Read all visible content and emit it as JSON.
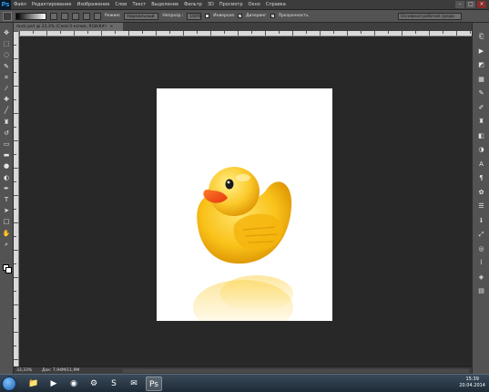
{
  "app": {
    "logo": "Ps"
  },
  "menu": [
    "Файл",
    "Редактирование",
    "Изображение",
    "Слои",
    "Текст",
    "Выделение",
    "Фильтр",
    "3D",
    "Просмотр",
    "Окно",
    "Справка"
  ],
  "window_controls": {
    "minimize": "–",
    "maximize": "□",
    "close": "×"
  },
  "options": {
    "mode_label": "Режим:",
    "mode_value": "Нормальный",
    "opacity_label": "Непрозр.:",
    "opacity_value": "100%",
    "inversion_label": "Инверсия",
    "dither_label": "Дизеринг",
    "transparency_label": "Прозрачность",
    "workspace": "Основная рабочая среда"
  },
  "document_tab": {
    "title": "duck.psd @ 33,3% (Слой 0 копия, RGB/8#)",
    "close": "×"
  },
  "status": {
    "zoom": "33,33%",
    "doc_info": "Док: 7,94M/11,9M"
  },
  "tools": [
    {
      "name": "move-tool-icon",
      "glyph": "✥"
    },
    {
      "name": "marquee-tool-icon",
      "glyph": "⬚"
    },
    {
      "name": "lasso-tool-icon",
      "glyph": "◌"
    },
    {
      "name": "quick-select-tool-icon",
      "glyph": "✎"
    },
    {
      "name": "crop-tool-icon",
      "glyph": "⌗"
    },
    {
      "name": "eyedropper-tool-icon",
      "glyph": "⁄"
    },
    {
      "name": "healing-brush-tool-icon",
      "glyph": "✚"
    },
    {
      "name": "brush-tool-icon",
      "glyph": "╱"
    },
    {
      "name": "clone-stamp-tool-icon",
      "glyph": "♜"
    },
    {
      "name": "history-brush-tool-icon",
      "glyph": "↺"
    },
    {
      "name": "eraser-tool-icon",
      "glyph": "▭"
    },
    {
      "name": "gradient-tool-icon",
      "glyph": "▬"
    },
    {
      "name": "blur-tool-icon",
      "glyph": "●"
    },
    {
      "name": "dodge-tool-icon",
      "glyph": "◐"
    },
    {
      "name": "pen-tool-icon",
      "glyph": "✒"
    },
    {
      "name": "type-tool-icon",
      "glyph": "T"
    },
    {
      "name": "path-select-tool-icon",
      "glyph": "➤"
    },
    {
      "name": "shape-tool-icon",
      "glyph": "□"
    },
    {
      "name": "hand-tool-icon",
      "glyph": "✋"
    },
    {
      "name": "zoom-tool-icon",
      "glyph": "⌕"
    }
  ],
  "panel_icons": [
    {
      "name": "history-panel-icon",
      "glyph": "⎗"
    },
    {
      "name": "actions-panel-icon",
      "glyph": "▶"
    },
    {
      "name": "color-panel-icon",
      "glyph": "◩"
    },
    {
      "name": "swatches-panel-icon",
      "glyph": "▦"
    },
    {
      "name": "brush-panel-icon",
      "glyph": "✎"
    },
    {
      "name": "brush-presets-panel-icon",
      "glyph": "✐"
    },
    {
      "name": "clone-source-panel-icon",
      "glyph": "♜"
    },
    {
      "name": "styles-panel-icon",
      "glyph": "◧"
    },
    {
      "name": "adjustments-panel-icon",
      "glyph": "◑"
    },
    {
      "name": "character-panel-icon",
      "glyph": "A"
    },
    {
      "name": "paragraph-panel-icon",
      "glyph": "¶"
    },
    {
      "name": "3d-panel-icon",
      "glyph": "✿"
    },
    {
      "name": "properties-panel-icon",
      "glyph": "☰"
    },
    {
      "name": "info-panel-icon",
      "glyph": "ℹ"
    },
    {
      "name": "navigator-panel-icon",
      "glyph": "⤢"
    },
    {
      "name": "channels-panel-icon",
      "glyph": "◎"
    },
    {
      "name": "paths-panel-icon",
      "glyph": "⌇"
    },
    {
      "name": "layers-panel-icon",
      "glyph": "◈"
    },
    {
      "name": "layer-comps-panel-icon",
      "glyph": "▤"
    }
  ],
  "taskbar": {
    "apps": [
      {
        "name": "explorer-taskbar-icon",
        "glyph": "📁"
      },
      {
        "name": "media-player-taskbar-icon",
        "glyph": "▶"
      },
      {
        "name": "chrome-taskbar-icon",
        "glyph": "◉"
      },
      {
        "name": "steam-taskbar-icon",
        "glyph": "⚙"
      },
      {
        "name": "skype-taskbar-icon",
        "glyph": "S"
      },
      {
        "name": "mail-taskbar-icon",
        "glyph": "✉"
      },
      {
        "name": "photoshop-taskbar-icon",
        "glyph": "Ps"
      }
    ],
    "time": "15:39",
    "date": "20.04.2014"
  },
  "colors": {
    "accent": "#31a8ff",
    "canvas_bg": "#282828",
    "panel_bg": "#535353"
  }
}
